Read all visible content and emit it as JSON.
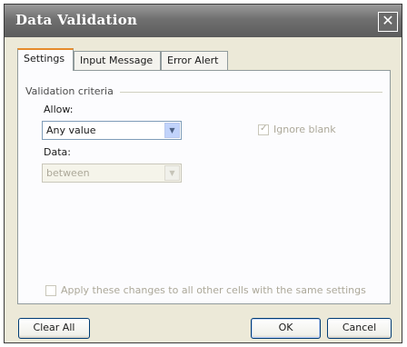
{
  "window": {
    "title": "Data Validation",
    "close_symbol": "✕"
  },
  "tabs": [
    {
      "label": "Settings",
      "active": true
    },
    {
      "label": "Input Message",
      "active": false
    },
    {
      "label": "Error Alert",
      "active": false
    }
  ],
  "validation_criteria": {
    "group_label": "Validation criteria",
    "allow": {
      "label": "Allow:",
      "value": "Any value"
    },
    "ignore_blank": {
      "label": "Ignore blank",
      "checked": true,
      "enabled": false
    },
    "data": {
      "label": "Data:",
      "value": "between",
      "enabled": false
    }
  },
  "apply_all": {
    "label": "Apply these changes to all other cells with the same settings",
    "checked": false,
    "enabled": false
  },
  "buttons": {
    "clear_all": "Clear All",
    "ok": "OK",
    "cancel": "Cancel"
  }
}
